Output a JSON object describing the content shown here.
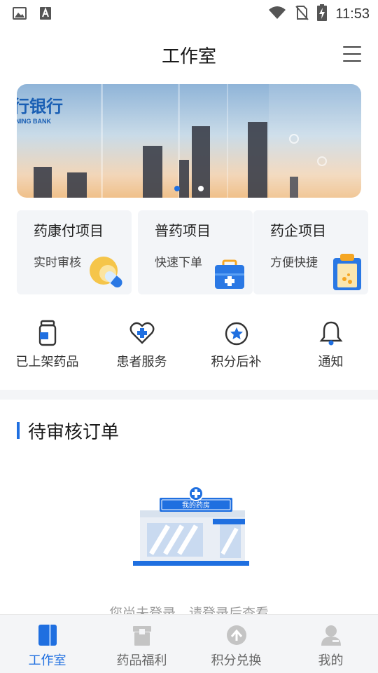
{
  "status_bar": {
    "time": "11:53",
    "icons": [
      "image-icon",
      "a-icon",
      "wifi-icon",
      "no-sim-icon",
      "battery-charging-icon"
    ]
  },
  "header": {
    "title": "工作室",
    "menu_icon": "menu-icon"
  },
  "banner": {
    "brand_text": "行银行",
    "brand_sub": "NING BANK",
    "slide_count": 2,
    "active_slide": 1
  },
  "cards": [
    {
      "title": "药康付项目",
      "subtitle": "实时审核",
      "icon": "pill-capsule-icon"
    },
    {
      "title": "普药项目",
      "subtitle": "快速下单",
      "icon": "medical-kit-icon"
    },
    {
      "title": "药企项目",
      "subtitle": "方便快捷",
      "icon": "clipboard-icon"
    }
  ],
  "quick_actions": [
    {
      "label": "已上架药品",
      "icon": "medicine-bottle-icon"
    },
    {
      "label": "患者服务",
      "icon": "heart-plus-icon"
    },
    {
      "label": "积分后补",
      "icon": "star-badge-icon"
    },
    {
      "label": "通知",
      "icon": "bell-icon"
    }
  ],
  "pending_orders": {
    "title": "待审核订单",
    "store_sign": "我的药房",
    "empty_text": "您尚未登录，请登录后查看"
  },
  "tab_bar": {
    "active_index": 0,
    "items": [
      {
        "label": "工作室",
        "icon": "book-icon"
      },
      {
        "label": "药品福利",
        "icon": "box-icon"
      },
      {
        "label": "积分兑换",
        "icon": "upload-cloud-icon"
      },
      {
        "label": "我的",
        "icon": "user-icon"
      }
    ]
  },
  "colors": {
    "accent": "#1f6fe0",
    "card_bg": "#f3f5f8",
    "page_bg": "#f4f5f7"
  }
}
